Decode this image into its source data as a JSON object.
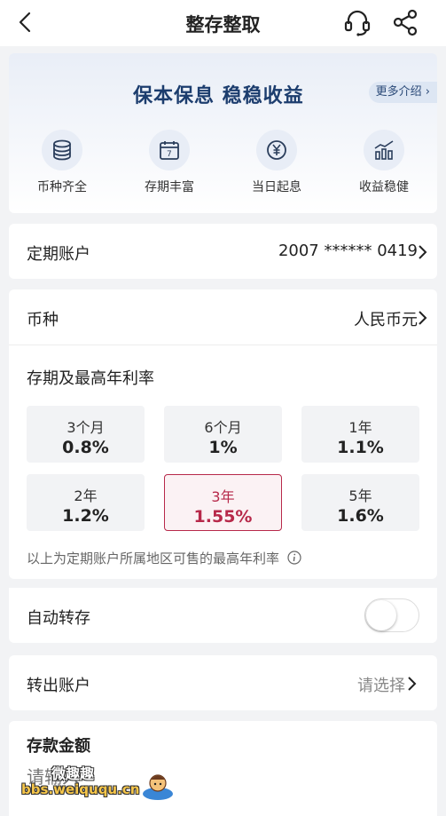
{
  "header": {
    "title": "整存整取"
  },
  "banner": {
    "slogan": "保本保息 稳稳收益",
    "more_label": "更多介绍 ›",
    "features": [
      {
        "label": "币种齐全",
        "icon": "coins-stack-icon"
      },
      {
        "label": "存期丰富",
        "icon": "calendar-icon"
      },
      {
        "label": "当日起息",
        "icon": "yen-circle-icon"
      },
      {
        "label": "收益稳健",
        "icon": "growth-chart-icon"
      }
    ]
  },
  "account": {
    "label": "定期账户",
    "value": "2007 ****** 0419"
  },
  "currency": {
    "label": "币种",
    "value": "人民币元"
  },
  "rates": {
    "heading": "存期及最高年利率",
    "items": [
      {
        "term": "3个月",
        "rate": "0.8%"
      },
      {
        "term": "6个月",
        "rate": "1%"
      },
      {
        "term": "1年",
        "rate": "1.1%"
      },
      {
        "term": "2年",
        "rate": "1.2%"
      },
      {
        "term": "3年",
        "rate": "1.55%"
      },
      {
        "term": "5年",
        "rate": "1.6%"
      }
    ],
    "selected_term": "3年",
    "note": "以上为定期账户所属地区可售的最高年利率"
  },
  "auto_renew": {
    "label": "自动转存",
    "enabled": false
  },
  "transfer_out": {
    "label": "转出账户",
    "placeholder": "请选择"
  },
  "deposit": {
    "label": "存款金额",
    "input_placeholder": "请输入"
  },
  "watermark": {
    "title": "微趣趣",
    "url": "bbs.weiququ.cn"
  },
  "colors": {
    "accent": "#b7294a",
    "banner_text": "#1c3d6e",
    "background": "#f2f3f5"
  }
}
